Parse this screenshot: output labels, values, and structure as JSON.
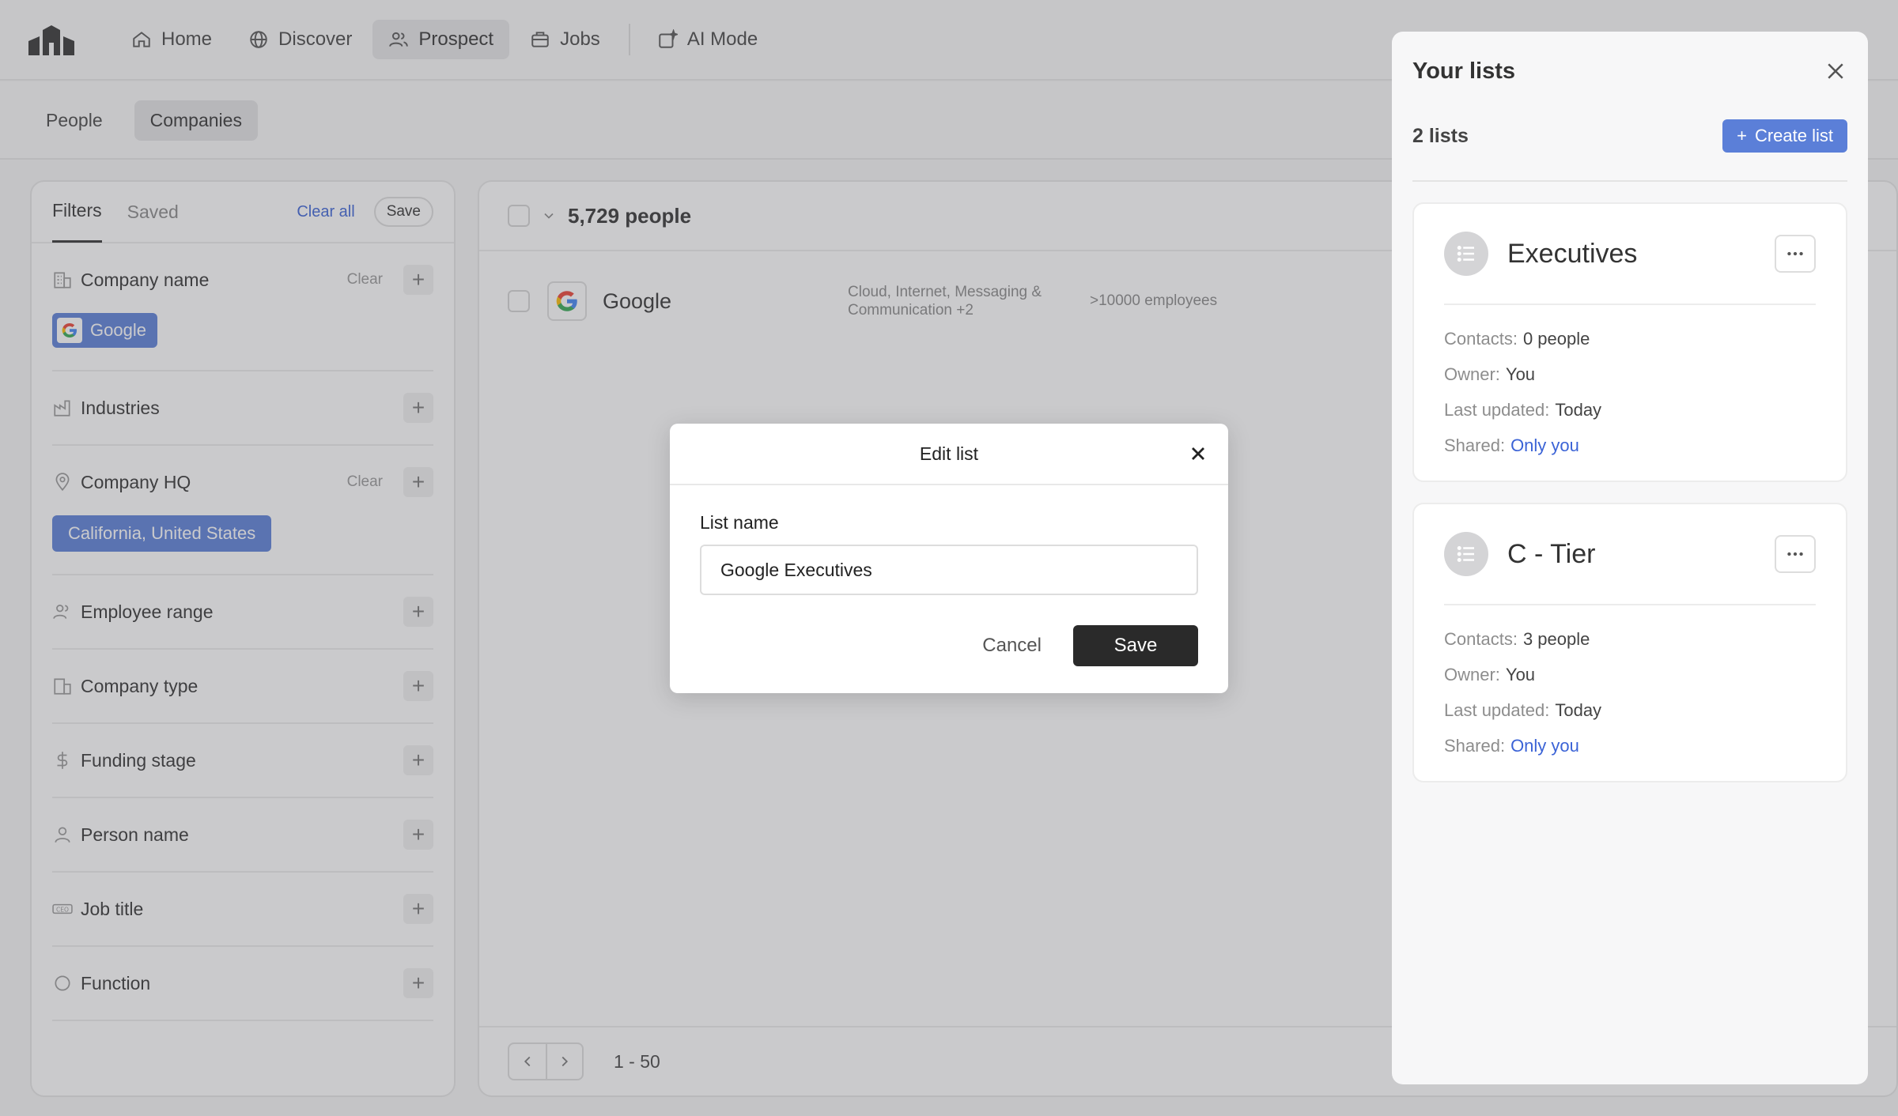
{
  "nav": {
    "items": [
      {
        "label": "Home",
        "icon": "home-icon"
      },
      {
        "label": "Discover",
        "icon": "globe-icon"
      },
      {
        "label": "Prospect",
        "icon": "users-icon",
        "active": true
      },
      {
        "label": "Jobs",
        "icon": "briefcase-icon"
      },
      {
        "label": "AI Mode",
        "icon": "ai-icon"
      }
    ]
  },
  "subtabs": {
    "people": "People",
    "companies": "Companies"
  },
  "filters": {
    "tab_filters": "Filters",
    "tab_saved": "Saved",
    "clear_all": "Clear all",
    "save": "Save",
    "clear": "Clear",
    "company_name": {
      "label": "Company name",
      "chip": "Google"
    },
    "industries": {
      "label": "Industries"
    },
    "company_hq": {
      "label": "Company HQ",
      "chip": "California, United States"
    },
    "employee_range": {
      "label": "Employee range"
    },
    "company_type": {
      "label": "Company type"
    },
    "funding_stage": {
      "label": "Funding stage"
    },
    "person_name": {
      "label": "Person name"
    },
    "job_title": {
      "label": "Job title"
    },
    "function": {
      "label": "Function"
    }
  },
  "results": {
    "count": "5,729 people",
    "rows": [
      {
        "name": "Google",
        "industries": "Cloud, Internet, Messaging & Communication +2",
        "size": ">10000 employees"
      }
    ],
    "range": "1 - 50"
  },
  "drawer": {
    "title": "Your lists",
    "count": "2 lists",
    "create": "Create list",
    "lists": [
      {
        "name": "Executives",
        "contacts_label": "Contacts:",
        "contacts": "0 people",
        "owner_label": "Owner:",
        "owner": "You",
        "updated_label": "Last updated:",
        "updated": "Today",
        "shared_label": "Shared:",
        "shared": "Only you"
      },
      {
        "name": "C - Tier",
        "contacts_label": "Contacts:",
        "contacts": "3 people",
        "owner_label": "Owner:",
        "owner": "You",
        "updated_label": "Last updated:",
        "updated": "Today",
        "shared_label": "Shared:",
        "shared": "Only you"
      }
    ]
  },
  "modal": {
    "title": "Edit list",
    "label": "List name",
    "value": "Google Executives",
    "cancel": "Cancel",
    "save": "Save"
  },
  "colors": {
    "accent": "#5b7fd8",
    "link": "#3b63d6",
    "primary_button": "#2a2a2a"
  }
}
